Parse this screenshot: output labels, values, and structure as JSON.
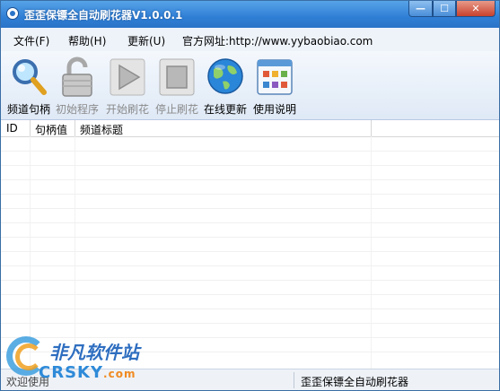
{
  "window": {
    "title": "歪歪保镖全自动刷花器V1.0.0.1",
    "buttons": {
      "minimize": "—",
      "maximize": "☐",
      "close": "✕"
    }
  },
  "menu": {
    "file": "文件(F)",
    "help": "帮助(H)",
    "update": "更新(U)",
    "website": "官方网址:http://www.yybaobiao.com"
  },
  "toolbar": {
    "items": [
      {
        "label": "频道句柄",
        "icon": "magnifier-icon",
        "enabled": true
      },
      {
        "label": "初始程序",
        "icon": "unlock-icon",
        "enabled": false
      },
      {
        "label": "开始刷花",
        "icon": "play-icon",
        "enabled": false
      },
      {
        "label": "停止刷花",
        "icon": "stop-icon",
        "enabled": false
      },
      {
        "label": "在线更新",
        "icon": "globe-icon",
        "enabled": true
      },
      {
        "label": "使用说明",
        "icon": "window-grid-icon",
        "enabled": true
      }
    ]
  },
  "list": {
    "columns": [
      "ID",
      "句柄值",
      "频道标题"
    ],
    "rows": []
  },
  "status": {
    "left": "欢迎使用",
    "right": "歪歪保镖全自动刷花器"
  },
  "watermark": {
    "cn": "非凡软件站",
    "en": "CRSKY",
    "domain": ".com"
  },
  "colors": {
    "titlebar": "#2f7fd6",
    "accent": "#3a6ea5"
  }
}
